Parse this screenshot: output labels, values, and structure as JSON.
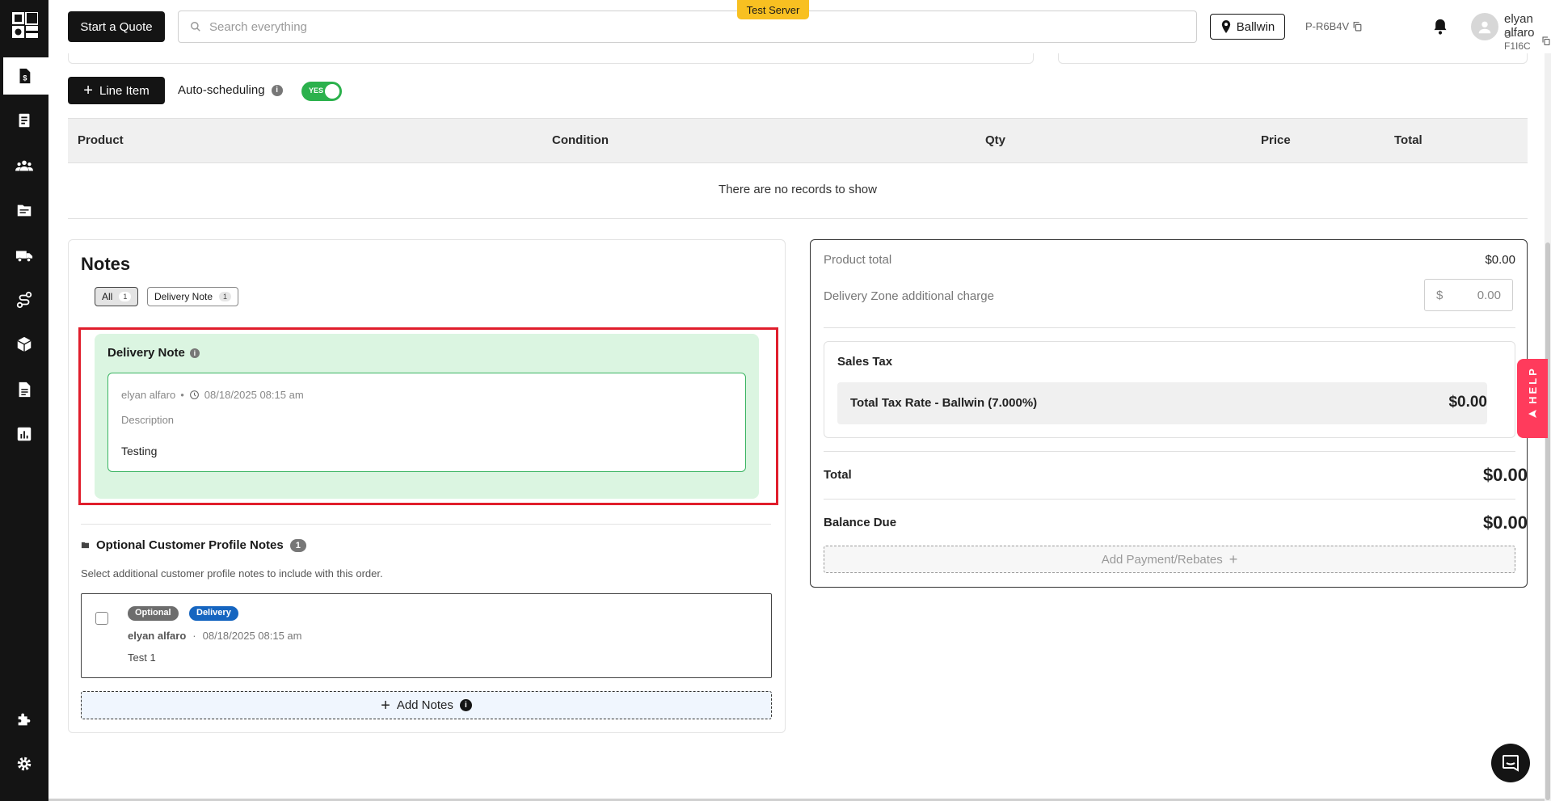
{
  "header": {
    "quote_button": "Start a Quote",
    "search_placeholder": "Search everything",
    "server_badge": "Test Server",
    "location": "Ballwin",
    "project_code": "P-R6B4V",
    "user_name": "elyan alfaro",
    "user_code": "U-F1I6C"
  },
  "toolbar": {
    "line_item_label": "Line Item",
    "auto_scheduling_label": "Auto-scheduling",
    "toggle_label": "YES",
    "toggle_on": true
  },
  "table": {
    "columns": [
      "Product",
      "Condition",
      "Qty",
      "Price",
      "Total"
    ],
    "empty_text": "There are no records to show"
  },
  "notes": {
    "title": "Notes",
    "filters": [
      {
        "label": "All",
        "count": "1",
        "active": true
      },
      {
        "label": "Delivery Note",
        "count": "1",
        "active": false
      }
    ],
    "delivery_note": {
      "title": "Delivery Note",
      "author": "elyan alfaro",
      "timestamp": "08/18/2025 08:15 am",
      "description_label": "Description",
      "description": "Testing"
    },
    "optional_profile_notes": {
      "title": "Optional Customer Profile Notes",
      "count": "1",
      "subtitle": "Select additional customer profile notes to include with this order.",
      "items": [
        {
          "tags": [
            "Optional",
            "Delivery"
          ],
          "author": "elyan alfaro",
          "timestamp": "08/18/2025 08:15 am",
          "text": "Test 1"
        }
      ]
    },
    "add_notes_label": "Add Notes"
  },
  "totals": {
    "product_total_label": "Product total",
    "product_total": "$0.00",
    "delivery_zone_label": "Delivery Zone additional charge",
    "delivery_zone_currency": "$",
    "delivery_zone_value": "0.00",
    "sales_tax_title": "Sales Tax",
    "tax_rate_label": "Total Tax Rate - Ballwin (7.000%)",
    "tax_rate_value": "$0.00",
    "total_label": "Total",
    "total_value": "$0.00",
    "balance_label": "Balance Due",
    "balance_value": "$0.00",
    "add_payment_label": "Add Payment/Rebates"
  },
  "help_label": "HELP",
  "colors": {
    "sidebar": "#141414",
    "accent_green": "#2bb14c",
    "note_bg": "#dbf5e1",
    "highlight_red": "#e01e2c",
    "help_pink": "#ff3b5c",
    "server_yellow": "#f8c021",
    "delivery_tag_blue": "#1565c0"
  },
  "icons": {
    "sidebar": [
      "quote-doc-icon",
      "invoice-icon",
      "customers-icon",
      "folder-icon",
      "truck-icon",
      "route-icon",
      "package-icon",
      "document-icon",
      "reports-icon",
      "puzzle-icon",
      "gear-icon"
    ]
  }
}
